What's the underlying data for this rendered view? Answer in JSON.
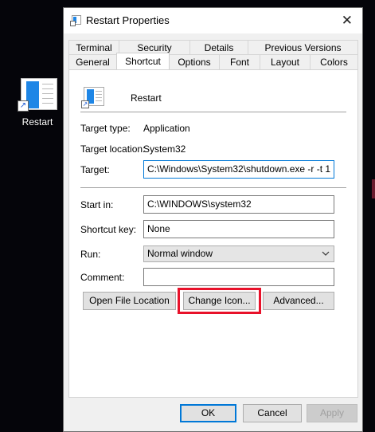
{
  "desktop": {
    "icon_label": "Restart"
  },
  "window": {
    "title": "Restart Properties",
    "tabs_back": [
      "Terminal",
      "Security",
      "Details",
      "Previous Versions"
    ],
    "tabs_front": [
      "General",
      "Shortcut",
      "Options",
      "Font",
      "Layout",
      "Colors"
    ],
    "active_tab": "Shortcut"
  },
  "shortcut": {
    "name": "Restart",
    "target_type_label": "Target type:",
    "target_type": "Application",
    "target_location_label": "Target location:",
    "target_location": "System32",
    "target_label": "Target:",
    "target": "C:\\Windows\\System32\\shutdown.exe -r -t 1",
    "start_in_label": "Start in:",
    "start_in": "C:\\WINDOWS\\system32",
    "shortcut_key_label": "Shortcut key:",
    "shortcut_key": "None",
    "run_label": "Run:",
    "run": "Normal window",
    "comment_label": "Comment:",
    "comment": ""
  },
  "buttons": {
    "open_file_location": "Open File Location",
    "change_icon": "Change Icon...",
    "advanced": "Advanced...",
    "ok": "OK",
    "cancel": "Cancel",
    "apply": "Apply"
  },
  "colors": {
    "highlight": "#e8112a",
    "accent": "#0078d7"
  }
}
